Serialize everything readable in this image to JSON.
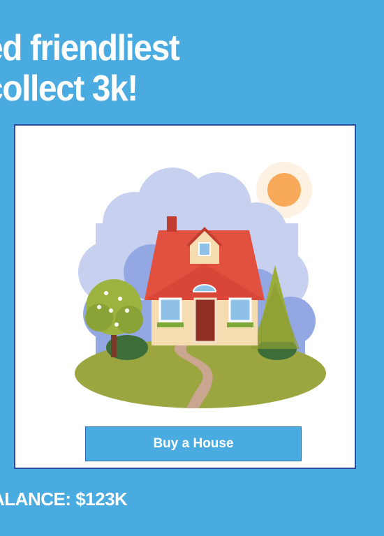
{
  "headline": {
    "line1": "ed friendliest",
    "line2": "collect 3k!"
  },
  "card": {
    "image_icon": "house-illustration",
    "buy_button_label": "Buy a House"
  },
  "balance": {
    "text": "ALANCE: $123K"
  },
  "colors": {
    "background": "#4aabe0",
    "card_border": "#2c4a9e",
    "button": "#4aabe0"
  }
}
